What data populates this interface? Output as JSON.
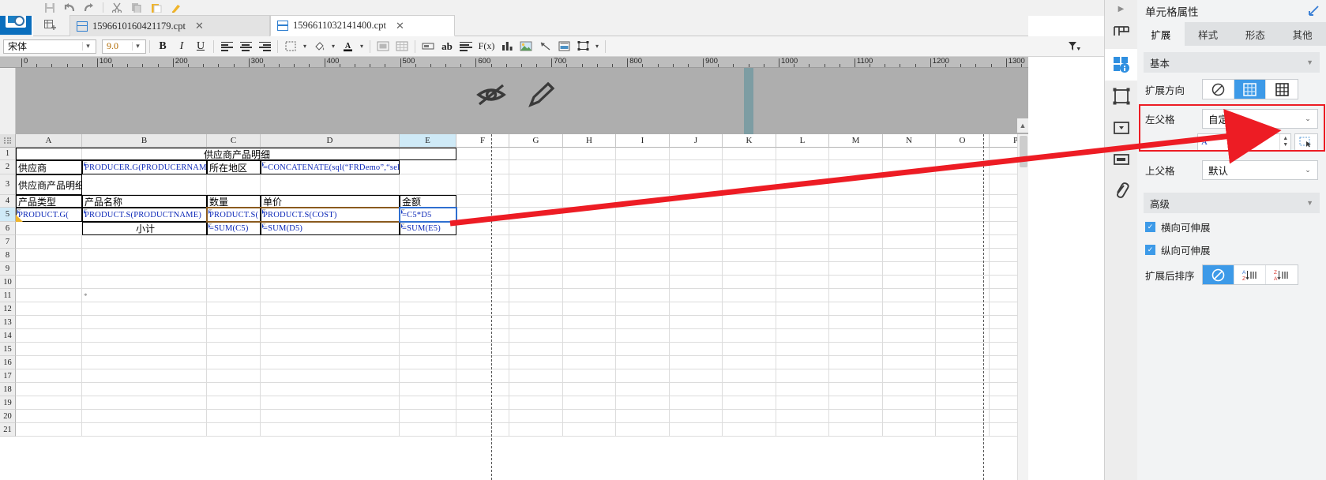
{
  "app": {
    "logo_icon": "app-logo-icon"
  },
  "toolbar_top": {
    "icons": [
      {
        "name": "save-icon",
        "glyph": "ὋE"
      },
      {
        "name": "undo-icon",
        "glyph": "↶"
      },
      {
        "name": "redo-icon",
        "glyph": "↷"
      },
      {
        "name": "cut-icon",
        "glyph": "✂"
      },
      {
        "name": "copy-icon",
        "glyph": "⧉"
      },
      {
        "name": "paste-icon",
        "glyph": "ὌB"
      },
      {
        "name": "format-painter-icon",
        "glyph": "὘C"
      }
    ]
  },
  "tabs": {
    "new_tab_label": "+",
    "items": [
      {
        "label": "1596610160421179.cpt",
        "active": false,
        "close": "✕"
      },
      {
        "label": "1596611032141400.cpt",
        "active": true,
        "close": "✕"
      }
    ]
  },
  "format_toolbar": {
    "font_name": "宋体",
    "font_size": "9.0",
    "bold": "B",
    "italic": "I",
    "underline": "U",
    "buttons": [
      {
        "name": "align-left-icon"
      },
      {
        "name": "align-center-icon"
      },
      {
        "name": "align-right-icon"
      },
      {
        "name": "border-icon"
      },
      {
        "name": "fill-color-icon"
      },
      {
        "name": "font-color-icon"
      },
      {
        "name": "merge-cells-icon"
      },
      {
        "name": "grid-icon"
      },
      {
        "name": "insert-textfield-icon"
      },
      {
        "name": "insert-label-icon",
        "glyph": "ab"
      },
      {
        "name": "paragraph-icon"
      },
      {
        "name": "formula-icon",
        "glyph": "F(x)"
      },
      {
        "name": "chart-icon"
      },
      {
        "name": "image-icon"
      },
      {
        "name": "pen-icon"
      },
      {
        "name": "report-block-icon"
      },
      {
        "name": "widget-icon"
      }
    ],
    "filter_icon": "filter-dropdown-icon"
  },
  "ruler": {
    "ticks": [
      0,
      100,
      200,
      300,
      400,
      500,
      600,
      700,
      800,
      900,
      1000,
      1100,
      1200,
      1300
    ]
  },
  "banner": {
    "icons": [
      {
        "name": "hidden-eye-icon"
      },
      {
        "name": "pencil-edit-icon"
      }
    ]
  },
  "sheet": {
    "columns": [
      "A",
      "B",
      "C",
      "D",
      "E",
      "F",
      "G",
      "H",
      "I",
      "J",
      "K",
      "L",
      "M",
      "N",
      "O",
      "P"
    ],
    "selected_column": "E",
    "rows": [
      1,
      2,
      3,
      4,
      5,
      6,
      7,
      8,
      9,
      10,
      11,
      12,
      13,
      14,
      15,
      16,
      17,
      18,
      19,
      20,
      21
    ],
    "selected_row": 5,
    "cells": [
      {
        "ref": "A1",
        "text": "供应商产品明细",
        "style": "cn",
        "align": "center",
        "merged": "A1:E1"
      },
      {
        "ref": "A2",
        "text": "供应商",
        "style": "cn"
      },
      {
        "ref": "B2",
        "text": "PRODUCER.G(PRODUCERNAME)",
        "style": "blue"
      },
      {
        "ref": "C2",
        "text": "所在地区",
        "style": "cn"
      },
      {
        "ref": "D2",
        "text": "=CONCATENATE(sql(“FRDemo”,“select *",
        "style": "blue"
      },
      {
        "ref": "A3",
        "text": "供应商产品明细",
        "style": "cn"
      },
      {
        "ref": "A4",
        "text": "产品类型",
        "style": "cn"
      },
      {
        "ref": "B4",
        "text": "产品名称",
        "style": "cn"
      },
      {
        "ref": "C4",
        "text": "数量",
        "style": "cn"
      },
      {
        "ref": "D4",
        "text": "单价",
        "style": "cn"
      },
      {
        "ref": "E4",
        "text": "金额",
        "style": "cn"
      },
      {
        "ref": "A5",
        "text": "PRODUCT.G(",
        "style": "blue"
      },
      {
        "ref": "B5",
        "text": "PRODUCT.S(PRODUCTNAME)",
        "style": "blue"
      },
      {
        "ref": "C5",
        "text": "PRODUCT.S(",
        "style": "blue"
      },
      {
        "ref": "D5",
        "text": "PRODUCT.S(COST)",
        "style": "blue"
      },
      {
        "ref": "E5",
        "text": "=C5*D5",
        "style": "blue"
      },
      {
        "ref": "B6",
        "text": "小计",
        "style": "cn",
        "align": "center"
      },
      {
        "ref": "C6",
        "text": "=SUM(C5)",
        "style": "blue"
      },
      {
        "ref": "D6",
        "text": "=SUM(D5)",
        "style": "blue"
      },
      {
        "ref": "E6",
        "text": "=SUM(E5)",
        "style": "blue"
      }
    ]
  },
  "icon_strip": {
    "collapse_glyph": "▶",
    "items": [
      {
        "name": "report-layout-icon",
        "active": false
      },
      {
        "name": "cell-attributes-icon",
        "active": true
      },
      {
        "name": "frame-icon",
        "active": false
      },
      {
        "name": "dropdown-widget-icon",
        "active": false
      },
      {
        "name": "form-widget-icon",
        "active": false
      },
      {
        "name": "hyperlink-icon",
        "active": false
      }
    ]
  },
  "right_panel": {
    "title": "单元格属性",
    "expand_icon": "expand-panel-icon",
    "tabs": [
      {
        "label": "扩展",
        "active": true
      },
      {
        "label": "样式",
        "active": false
      },
      {
        "label": "形态",
        "active": false
      },
      {
        "label": "其他",
        "active": false
      }
    ],
    "basic_section": "基本",
    "expand_direction": {
      "label": "扩展方向",
      "options": [
        {
          "name": "no-expand-icon",
          "active": false
        },
        {
          "name": "vertical-expand-icon",
          "active": true
        },
        {
          "name": "horizontal-expand-icon",
          "active": false
        }
      ]
    },
    "left_parent": {
      "label": "左父格",
      "value": "自定义",
      "caret": "⌄",
      "col_value": "A",
      "row_value": "5",
      "picker_icon": "cell-picker-icon"
    },
    "top_parent": {
      "label": "上父格",
      "value": "默认",
      "caret": "⌄"
    },
    "advanced_section": "高级",
    "checkboxes": [
      {
        "label": "横向可伸展",
        "checked": true
      },
      {
        "label": "纵向可伸展",
        "checked": true
      }
    ],
    "sort_after_expand": {
      "label": "扩展后排序",
      "options": [
        {
          "name": "no-sort-icon",
          "active": true
        },
        {
          "name": "sort-ascending-icon",
          "active": false
        },
        {
          "name": "sort-descending-icon",
          "active": false
        }
      ]
    }
  },
  "annotation": {
    "arrow_color": "#ed1c24",
    "highlight_color": "#ed1c24"
  }
}
